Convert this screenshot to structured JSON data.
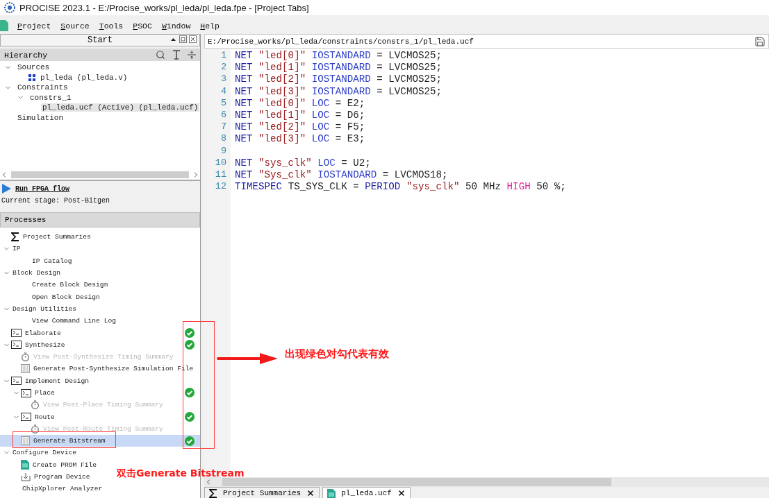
{
  "window": {
    "title": "PROCISE 2023.1  - E:/Procise_works/pl_leda/pl_leda.fpe - [Project Tabs]"
  },
  "menu": [
    "Project",
    "Source",
    "Tools",
    "PSOC",
    "Window",
    "Help"
  ],
  "start_panel": {
    "title": "Start"
  },
  "hierarchy": {
    "title": "Hierarchy",
    "items": [
      {
        "label": "Sources",
        "expanded": true,
        "selected": false,
        "children": [
          {
            "label": "pl_leda (pl_leda.v)",
            "kind": "module",
            "selected": false
          }
        ]
      },
      {
        "label": "Constraints",
        "expanded": true,
        "selected": false,
        "children": [
          {
            "label": "constrs_1",
            "expanded": true,
            "selected": false,
            "children": [
              {
                "label": "pl_leda.ucf (Active) (pl_leda.ucf)",
                "selected": true
              }
            ]
          }
        ]
      },
      {
        "label": "Simulation",
        "selected": false
      }
    ]
  },
  "flow": {
    "link": "Run FPGA flow",
    "stage": "Current stage: Post-Bitgen"
  },
  "processes": {
    "title": "Processes",
    "items": [
      {
        "label": "Project Summaries",
        "kind": "sigma",
        "selected": false,
        "done": false,
        "disabled": false
      },
      {
        "label": "IP",
        "expanded": true,
        "selected": false,
        "done": false,
        "disabled": false,
        "children": [
          {
            "label": "IP Catalog",
            "selected": false,
            "done": false,
            "disabled": false
          }
        ]
      },
      {
        "label": "Block Design",
        "expanded": true,
        "selected": false,
        "done": false,
        "disabled": false,
        "children": [
          {
            "label": "Create Block Design",
            "selected": false,
            "done": false,
            "disabled": false
          },
          {
            "label": "Open Block Design",
            "selected": false,
            "done": false,
            "disabled": false
          }
        ]
      },
      {
        "label": "Design Utilities",
        "expanded": true,
        "selected": false,
        "done": false,
        "disabled": false,
        "children": [
          {
            "label": "View Command Line Log",
            "selected": false,
            "done": false,
            "disabled": false
          }
        ]
      },
      {
        "label": "Elaborate",
        "kind": "terminal",
        "selected": false,
        "done": true,
        "disabled": false
      },
      {
        "label": "Synthesize",
        "kind": "terminal",
        "expanded": true,
        "selected": false,
        "done": true,
        "disabled": false,
        "children": [
          {
            "label": "View Post-Synthesize Timing Summary",
            "kind": "timer",
            "selected": false,
            "done": false,
            "disabled": true
          },
          {
            "label": "Generate Post-Synthesize Simulation File",
            "kind": "grid",
            "selected": false,
            "done": false,
            "disabled": false
          }
        ]
      },
      {
        "label": "Implement Design",
        "kind": "terminal",
        "expanded": true,
        "selected": false,
        "done": false,
        "disabled": false,
        "children": [
          {
            "label": "Place",
            "kind": "terminal",
            "expanded": true,
            "selected": false,
            "done": true,
            "disabled": false,
            "children": [
              {
                "label": "View Post-Place Timing Summary",
                "kind": "timer",
                "selected": false,
                "done": false,
                "disabled": true
              }
            ]
          },
          {
            "label": "Route",
            "kind": "terminal",
            "expanded": true,
            "selected": false,
            "done": true,
            "disabled": false,
            "children": [
              {
                "label": "View Post-Route Timing Summary",
                "kind": "timer",
                "selected": false,
                "done": false,
                "disabled": true
              }
            ]
          },
          {
            "label": "Generate Bitstream",
            "kind": "grid",
            "selected": true,
            "done": true,
            "disabled": false
          }
        ]
      },
      {
        "label": "Configure Device",
        "expanded": true,
        "selected": false,
        "done": false,
        "disabled": false,
        "children": [
          {
            "label": "Create PROM File",
            "kind": "document",
            "selected": false,
            "done": false,
            "disabled": false
          },
          {
            "label": "Program Device",
            "kind": "download",
            "selected": false,
            "done": false,
            "disabled": false
          }
        ]
      },
      {
        "label": "ChipXplorer Analyzer",
        "selected": false,
        "done": false,
        "disabled": false
      }
    ]
  },
  "editor": {
    "path": "E:/Procise_works/pl_leda/constraints/constrs_1/pl_leda.ucf",
    "lines": [
      {
        "number": "1",
        "tokens": [
          {
            "kind": "keyword",
            "text": "NET"
          },
          {
            "kind": "string",
            "text": "\"led[0]\""
          },
          {
            "kind": "attribute",
            "text": "IOSTANDARD"
          },
          {
            "kind": "plain",
            "text": "= LVCMOS25;"
          }
        ]
      },
      {
        "number": "2",
        "tokens": [
          {
            "kind": "keyword",
            "text": "NET"
          },
          {
            "kind": "string",
            "text": "\"led[1]\""
          },
          {
            "kind": "attribute",
            "text": "IOSTANDARD"
          },
          {
            "kind": "plain",
            "text": "= LVCMOS25;"
          }
        ]
      },
      {
        "number": "3",
        "tokens": [
          {
            "kind": "keyword",
            "text": "NET"
          },
          {
            "kind": "string",
            "text": "\"led[2]\""
          },
          {
            "kind": "attribute",
            "text": "IOSTANDARD"
          },
          {
            "kind": "plain",
            "text": "= LVCMOS25;"
          }
        ]
      },
      {
        "number": "4",
        "tokens": [
          {
            "kind": "keyword",
            "text": "NET"
          },
          {
            "kind": "string",
            "text": "\"led[3]\""
          },
          {
            "kind": "attribute",
            "text": "IOSTANDARD"
          },
          {
            "kind": "plain",
            "text": "= LVCMOS25;"
          }
        ]
      },
      {
        "number": "5",
        "tokens": [
          {
            "kind": "keyword",
            "text": "NET"
          },
          {
            "kind": "string",
            "text": "\"led[0]\""
          },
          {
            "kind": "attribute",
            "text": "LOC"
          },
          {
            "kind": "plain",
            "text": "= E2;"
          }
        ]
      },
      {
        "number": "6",
        "tokens": [
          {
            "kind": "keyword",
            "text": "NET"
          },
          {
            "kind": "string",
            "text": "\"led[1]\""
          },
          {
            "kind": "attribute",
            "text": "LOC"
          },
          {
            "kind": "plain",
            "text": "= D6;"
          }
        ]
      },
      {
        "number": "7",
        "tokens": [
          {
            "kind": "keyword",
            "text": "NET"
          },
          {
            "kind": "string",
            "text": "\"led[2]\""
          },
          {
            "kind": "attribute",
            "text": "LOC"
          },
          {
            "kind": "plain",
            "text": "= F5;"
          }
        ]
      },
      {
        "number": "8",
        "tokens": [
          {
            "kind": "keyword",
            "text": "NET"
          },
          {
            "kind": "string",
            "text": "\"led[3]\""
          },
          {
            "kind": "attribute",
            "text": "LOC"
          },
          {
            "kind": "plain",
            "text": "= E3;"
          }
        ]
      },
      {
        "number": "9"
      },
      {
        "number": "10",
        "tokens": [
          {
            "kind": "keyword",
            "text": "NET"
          },
          {
            "kind": "string",
            "text": "\"sys_clk\""
          },
          {
            "kind": "attribute",
            "text": "LOC"
          },
          {
            "kind": "plain",
            "text": "= U2;"
          }
        ]
      },
      {
        "number": "11",
        "tokens": [
          {
            "kind": "keyword",
            "text": "NET"
          },
          {
            "kind": "string",
            "text": "\"Sys_clk\""
          },
          {
            "kind": "attribute",
            "text": "IOSTANDARD"
          },
          {
            "kind": "plain",
            "text": "= LVCMOS18;"
          }
        ]
      },
      {
        "number": "12",
        "tokens": [
          {
            "kind": "keyword",
            "text": "TIMESPEC"
          },
          {
            "kind": "plain",
            "text": "TS_SYS_CLK ="
          },
          {
            "kind": "keyword",
            "text": "PERIOD"
          },
          {
            "kind": "string",
            "text": "\"sys_clk\""
          },
          {
            "kind": "plain",
            "text": "50 MHz"
          },
          {
            "kind": "highlight",
            "text": "HIGH"
          },
          {
            "kind": "plain",
            "text": "50 %;"
          }
        ]
      }
    ]
  },
  "bottom_tabs": [
    {
      "label": "Project Summaries",
      "kind": "sigma",
      "selected": false
    },
    {
      "label": "pl_leda.ucf",
      "kind": "document",
      "selected": true
    }
  ],
  "annotations": [
    {
      "kind": "box"
    },
    {
      "kind": "box"
    },
    {
      "kind": "arrow"
    },
    {
      "kind": "note",
      "text": "出现绿色对勾代表有效"
    },
    {
      "kind": "note",
      "text": "双击Generate Bitstream"
    }
  ]
}
